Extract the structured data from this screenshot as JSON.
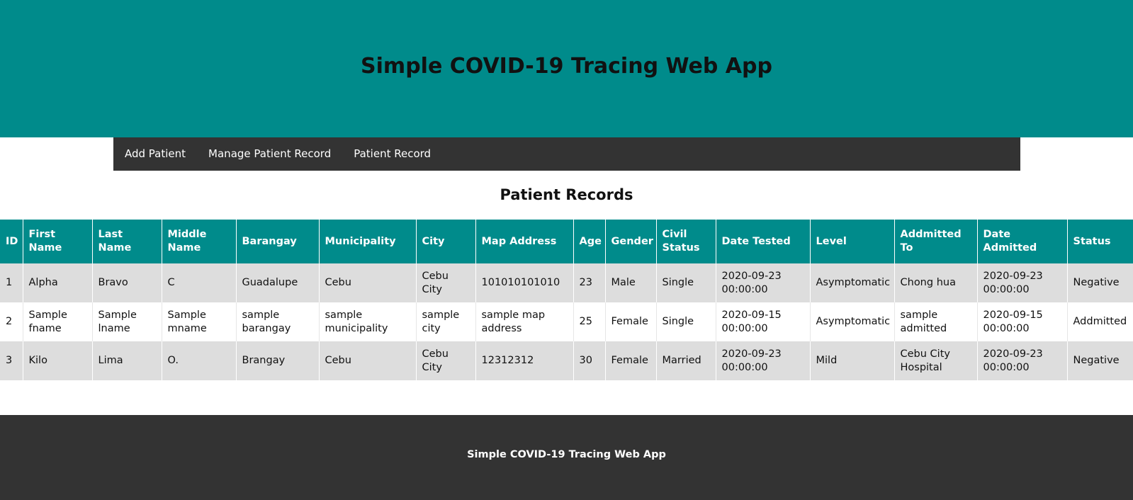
{
  "header": {
    "title": "Simple COVID-19 Tracing Web App"
  },
  "nav": {
    "items": [
      {
        "label": "Add Patient"
      },
      {
        "label": "Manage Patient Record"
      },
      {
        "label": "Patient Record"
      }
    ]
  },
  "main": {
    "title": "Patient Records",
    "columns": [
      "ID",
      "First Name",
      "Last Name",
      "Middle Name",
      "Barangay",
      "Municipality",
      "City",
      "Map Address",
      "Age",
      "Gender",
      "Civil Status",
      "Date Tested",
      "Level",
      "Addmitted To",
      "Date Admitted",
      "Status"
    ],
    "rows": [
      [
        "1",
        "Alpha",
        "Bravo",
        "C",
        "Guadalupe",
        "Cebu",
        "Cebu City",
        "101010101010",
        "23",
        "Male",
        "Single",
        "2020-09-23 00:00:00",
        "Asymptomatic",
        "Chong hua",
        "2020-09-23 00:00:00",
        "Negative"
      ],
      [
        "2",
        "Sample fname",
        "Sample lname",
        "Sample mname",
        "sample barangay",
        "sample municipality",
        "sample city",
        "sample map address",
        "25",
        "Female",
        "Single",
        "2020-09-15 00:00:00",
        "Asymptomatic",
        "sample admitted",
        "2020-09-15 00:00:00",
        "Addmitted"
      ],
      [
        "3",
        "Kilo",
        "Lima",
        "O.",
        "Brangay",
        "Cebu",
        "Cebu City",
        "12312312",
        "30",
        "Female",
        "Married",
        "2020-09-23 00:00:00",
        "Mild",
        "Cebu City Hospital",
        "2020-09-23 00:00:00",
        "Negative"
      ]
    ]
  },
  "footer": {
    "text": "Simple COVID-19 Tracing Web App"
  },
  "colors": {
    "header_bg": "#008b8b",
    "nav_bg": "#333333",
    "footer_bg": "#333333",
    "row_alt_bg": "#dddddd"
  }
}
